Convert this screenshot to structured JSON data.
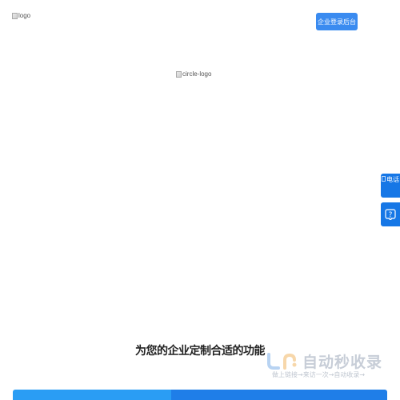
{
  "header": {
    "logo_alt": "logo",
    "login_button": "企业登录后台"
  },
  "hero": {
    "circle_logo_alt": "circle-logo"
  },
  "side_tools": {
    "phone_alt": "电话",
    "help_label": "?"
  },
  "features": {
    "title": "为您的企业定制合适的功能"
  },
  "watermark": {
    "title": "自动秒收录",
    "subtitle": "做上链接→来访一次→自动收录→"
  },
  "colors": {
    "primary": "#3a8bf0",
    "side": "#1677e6",
    "bar_a": "#2a9df4",
    "bar_b": "#1f7ee8"
  }
}
